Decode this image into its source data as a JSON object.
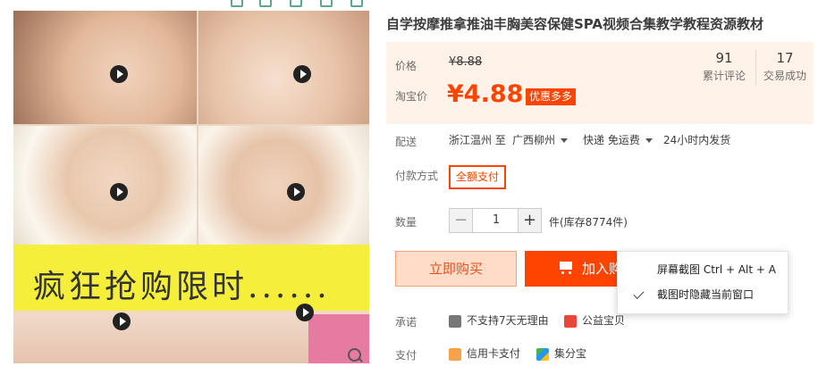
{
  "title": "自学按摩推拿推油丰胸美容保健SPA视频合集教学教程资源教材",
  "gallery": {
    "banner_text": "疯狂抢购限时......"
  },
  "price": {
    "label": "价格",
    "original": "¥8.88",
    "taobao_label": "淘宝价",
    "sale": "¥4.88",
    "promo_badge": "优惠多多"
  },
  "stats": {
    "reviews_count": "91",
    "reviews_label": "累计评论",
    "trades_count": "17",
    "trades_label": "交易成功"
  },
  "shipping": {
    "label": "配送",
    "origin": "浙江温州 至",
    "destination": "广西柳州",
    "method": "快递 免运费",
    "dispatch": "24小时内发货"
  },
  "payment_method": {
    "label": "付款方式",
    "option": "全额支付"
  },
  "quantity": {
    "label": "数量",
    "value": "1",
    "minus": "−",
    "plus": "+",
    "stock": "件(库存8774件)"
  },
  "actions": {
    "buy_now": "立即购买",
    "add_to_cart": "加入购"
  },
  "promise": {
    "label": "承诺",
    "item1": "不支持7天无理由",
    "item2": "公益宝贝"
  },
  "pay": {
    "label": "支付",
    "item1": "信用卡支付",
    "item2": "集分宝"
  },
  "context_menu": {
    "item1": "屏幕截图 Ctrl + Alt + A",
    "item2": "截图时隐藏当前窗口"
  },
  "colors": {
    "accent": "#ff4400",
    "price_panel": "#fff2e8",
    "banner": "#f5ef3c"
  }
}
